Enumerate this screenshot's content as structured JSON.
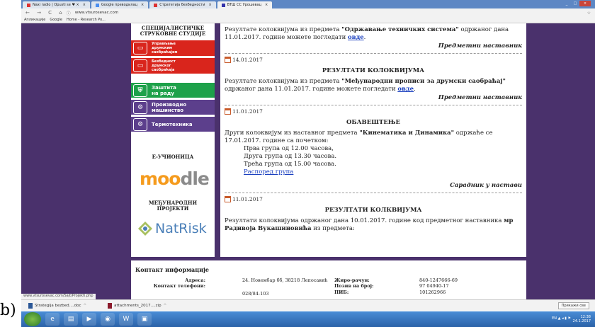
{
  "label": "b)",
  "browser": {
    "tabs": [
      {
        "label": "Naxi radio | Opusti se  ♥ ×",
        "active": false,
        "fav": "#d33"
      },
      {
        "label": "Google преводилац",
        "active": false,
        "fav": "#4a8ef0"
      },
      {
        "label": "Стратегија безбедности",
        "active": false,
        "fav": "#d33"
      },
      {
        "label": "ВТШ СС Урошевац",
        "active": true,
        "fav": "#33a"
      }
    ],
    "url": "www.vtsurosevac.com",
    "bookmarks": [
      "Апликације",
      "Google",
      "Home - Research Po..."
    ],
    "window_controls": [
      "_",
      "□",
      "×"
    ]
  },
  "sidebar": {
    "heading_1": "СПЕЦИЈАЛИСТИЧКЕ",
    "heading_2": "СТРУКОВНЕ СТУДИЈЕ",
    "items": [
      {
        "line1": "Управљање",
        "line2": "друмским",
        "line3": "саобраћајем",
        "color": "#d9251c",
        "icon": "car-icon"
      },
      {
        "line1": "Безбедност",
        "line2": "друмског",
        "line3": "саобраћаја",
        "color": "#d9251c",
        "icon": "car-icon"
      },
      {
        "line1": "Заштита",
        "line2": "на раду",
        "line3": "",
        "color": "#1ea14a",
        "icon": "shield-icon"
      },
      {
        "line1": "Производно",
        "line2": "машинство",
        "line3": "",
        "color": "#5c3f8c",
        "icon": "gear-icon"
      },
      {
        "line1": "Термотехника",
        "line2": "",
        "line3": "",
        "color": "#5c3f8c",
        "icon": "gear-icon"
      }
    ],
    "elearning": "Е-УЧИОНИЦА",
    "moodle": "moodle",
    "intl_1": "МЕЂУНАРОДНИ",
    "intl_2": "ПРОЈЕКТИ",
    "natrisk": "NatRisk"
  },
  "content": {
    "top": {
      "text_before": "Резултате колоквијума из предмета ",
      "subject": "\"Одржавање техничких система\"",
      "text_after": " одржаног дана 11.01.2017. године можете погледати ",
      "link": "овде",
      "end": ".",
      "sig": "Предметни наставник"
    },
    "post1": {
      "date": "14.01.2017",
      "title": "РЕЗУЛТАТИ КОЛОКВИЈУМА",
      "text_before": "Резултате колоквијума из предмета ",
      "subject": "\"Међународни прописи за друмски саобраћај\"",
      "text_after": " одржаног дана 11.01.2017. године можете погледати ",
      "link": "овде",
      "end": ".",
      "sig": "Предметни наставник"
    },
    "post2": {
      "date": "11.01.2017",
      "title": "ОБАВЕШТЕЊЕ",
      "text_before": "Други колоквијум из наставног предмета ",
      "subject": "\"Кинематика и Динамика\"",
      "text_after": " одржаће се 17.01.2017. године са почетком:",
      "groups": [
        "Прва група од 12.00 часова,",
        "Друга група од 13.30 часова.",
        "Трећа група од 15.00 часова."
      ],
      "link": "Распоред група",
      "sig": "Сарадник у настави"
    },
    "post3": {
      "date": "11.01.2017",
      "title": "РЕЗУЛТАТИ КОЛКВИЈУМА",
      "text_before": "Резултати колоквијума одржаног дана 10.01.2017. године код предметног наставника ",
      "name": "мр Радивоја Вукашиновића",
      "text_after": " из предмета:"
    }
  },
  "footer": {
    "heading": "Контакт информације",
    "address_label": "Адреса:",
    "address_value": "24. Новембар бб, 38218 Лепосавић",
    "phone_label": "Контакт телефони:",
    "phone_value": "028/84-103",
    "account_label": "Жиро-рачун:",
    "account_value": "840-1247666-69",
    "ref_label": "Позив на број:",
    "ref_value": "97 04940-17",
    "pib_label": "ПИБ:",
    "pib_value": "101262966"
  },
  "status_url": "www.vtsurosevac.com/Sajt/Projekti.php",
  "downloads": {
    "items": [
      "Strategija bezbed....doc",
      "attachments_2017....zip"
    ],
    "show_all": "Прикажи све"
  },
  "taskbar": {
    "time": "12:38",
    "date": "24.1.2017",
    "lang": "EN"
  }
}
